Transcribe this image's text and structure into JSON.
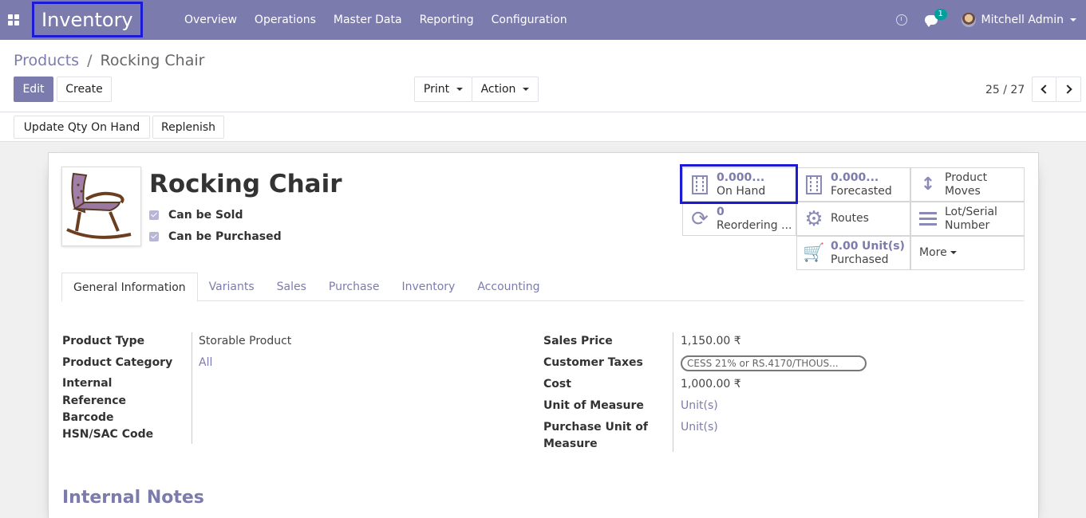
{
  "navbar": {
    "brand": "Inventory",
    "menu": [
      "Overview",
      "Operations",
      "Master Data",
      "Reporting",
      "Configuration"
    ],
    "chat_badge": "1",
    "user_name": "Mitchell Admin"
  },
  "breadcrumb": {
    "parent": "Products",
    "separator": "/",
    "current": "Rocking Chair"
  },
  "actions": {
    "edit": "Edit",
    "create": "Create",
    "print": "Print",
    "action": "Action",
    "pager": "25 / 27"
  },
  "statusbar": {
    "update_qty": "Update Qty On Hand",
    "replenish": "Replenish"
  },
  "product": {
    "name": "Rocking Chair",
    "can_be_sold": "Can be Sold",
    "can_be_purchased": "Can be Purchased"
  },
  "stats": {
    "on_hand_value": "0.000...",
    "on_hand_label": "On Hand",
    "forecasted_value": "0.000...",
    "forecasted_label": "Forecasted",
    "product_moves_l1": "Product",
    "product_moves_l2": "Moves",
    "reordering_value": "0",
    "reordering_label": "Reordering ...",
    "routes": "Routes",
    "lot_serial_l1": "Lot/Serial",
    "lot_serial_l2": "Number",
    "purchased_value": "0.00",
    "purchased_unit": "Unit(s)",
    "purchased_label": "Purchased",
    "more": "More"
  },
  "tabs": [
    "General Information",
    "Variants",
    "Sales",
    "Purchase",
    "Inventory",
    "Accounting"
  ],
  "fields_left": {
    "product_type_label": "Product Type",
    "product_type": "Storable Product",
    "product_category_label": "Product Category",
    "product_category": "All",
    "internal_ref_label_1": "Internal",
    "internal_ref_label_2": "Reference",
    "barcode_label": "Barcode",
    "hsn_label": "HSN/SAC Code"
  },
  "fields_right": {
    "sales_price_label": "Sales Price",
    "sales_price": "1,150.00 ₹",
    "customer_taxes_label": "Customer Taxes",
    "customer_taxes_tag": "CESS 21% or RS.4170/THOUS...",
    "cost_label": "Cost",
    "cost": "1,000.00 ₹",
    "uom_label": "Unit of Measure",
    "uom": "Unit(s)",
    "purchase_uom_label_1": "Purchase Unit of",
    "purchase_uom_label_2": "Measure",
    "purchase_uom": "Unit(s)"
  },
  "internal_notes_heading": "Internal Notes",
  "colors": {
    "brand": "#7c7bad",
    "highlight_box": "#1b1bd6",
    "badge": "#00a09d"
  }
}
